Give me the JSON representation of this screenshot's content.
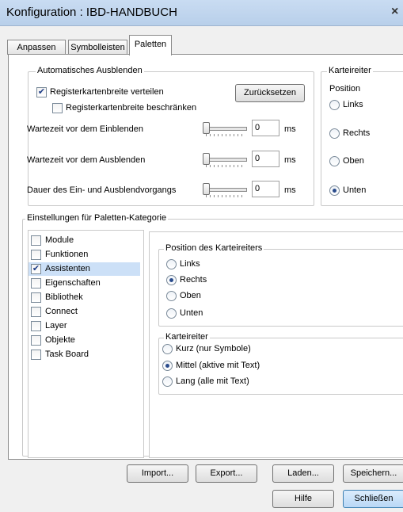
{
  "window": {
    "title": "Konfiguration : IBD-HANDBUCH",
    "close_glyph": "×"
  },
  "tabs": [
    {
      "label": "Anpassen"
    },
    {
      "label": "Symbolleisten"
    },
    {
      "label": "Paletten",
      "active": true
    }
  ],
  "auto_hide": {
    "legend": "Automatisches Ausblenden",
    "distribute_label": "Registerkartenbreite verteilen",
    "distribute_checked": true,
    "limit_label": "Registerkartenbreite beschränken",
    "limit_checked": false,
    "reset_button": "Zurücksetzen",
    "rows": [
      {
        "label": "Wartezeit vor dem Einblenden",
        "value": "0",
        "unit": "ms"
      },
      {
        "label": "Wartezeit vor dem Ausblenden",
        "value": "0",
        "unit": "ms"
      },
      {
        "label": "Dauer des Ein- und Ausblendvorgangs",
        "value": "0",
        "unit": "ms"
      }
    ]
  },
  "tab_panel": {
    "legend": "Karteireiter",
    "position_label": "Position",
    "options": [
      "Links",
      "Rechts",
      "Oben",
      "Unten"
    ],
    "selected": "Unten"
  },
  "category_settings": {
    "legend": "Einstellungen für Paletten-Kategorie",
    "items": [
      {
        "label": "Module",
        "checked": false
      },
      {
        "label": "Funktionen",
        "checked": false
      },
      {
        "label": "Assistenten",
        "checked": true,
        "selected": true
      },
      {
        "label": "Eigenschaften",
        "checked": false
      },
      {
        "label": "Bibliothek",
        "checked": false
      },
      {
        "label": "Connect",
        "checked": false
      },
      {
        "label": "Layer",
        "checked": false
      },
      {
        "label": "Objekte",
        "checked": false
      },
      {
        "label": "Task Board",
        "checked": false
      }
    ],
    "position_group": {
      "legend": "Position des Karteireiters",
      "options": [
        "Links",
        "Rechts",
        "Oben",
        "Unten"
      ],
      "selected": "Rechts"
    },
    "tab_group": {
      "legend": "Karteireiter",
      "options": [
        "Kurz (nur Symbole)",
        "Mittel (aktive mit Text)",
        "Lang (alle mit Text)"
      ],
      "selected": "Mittel (aktive mit Text)"
    }
  },
  "buttons": {
    "import": "Import...",
    "export": "Export...",
    "load": "Laden...",
    "save": "Speichern...",
    "help": "Hilfe",
    "close": "Schließen"
  }
}
